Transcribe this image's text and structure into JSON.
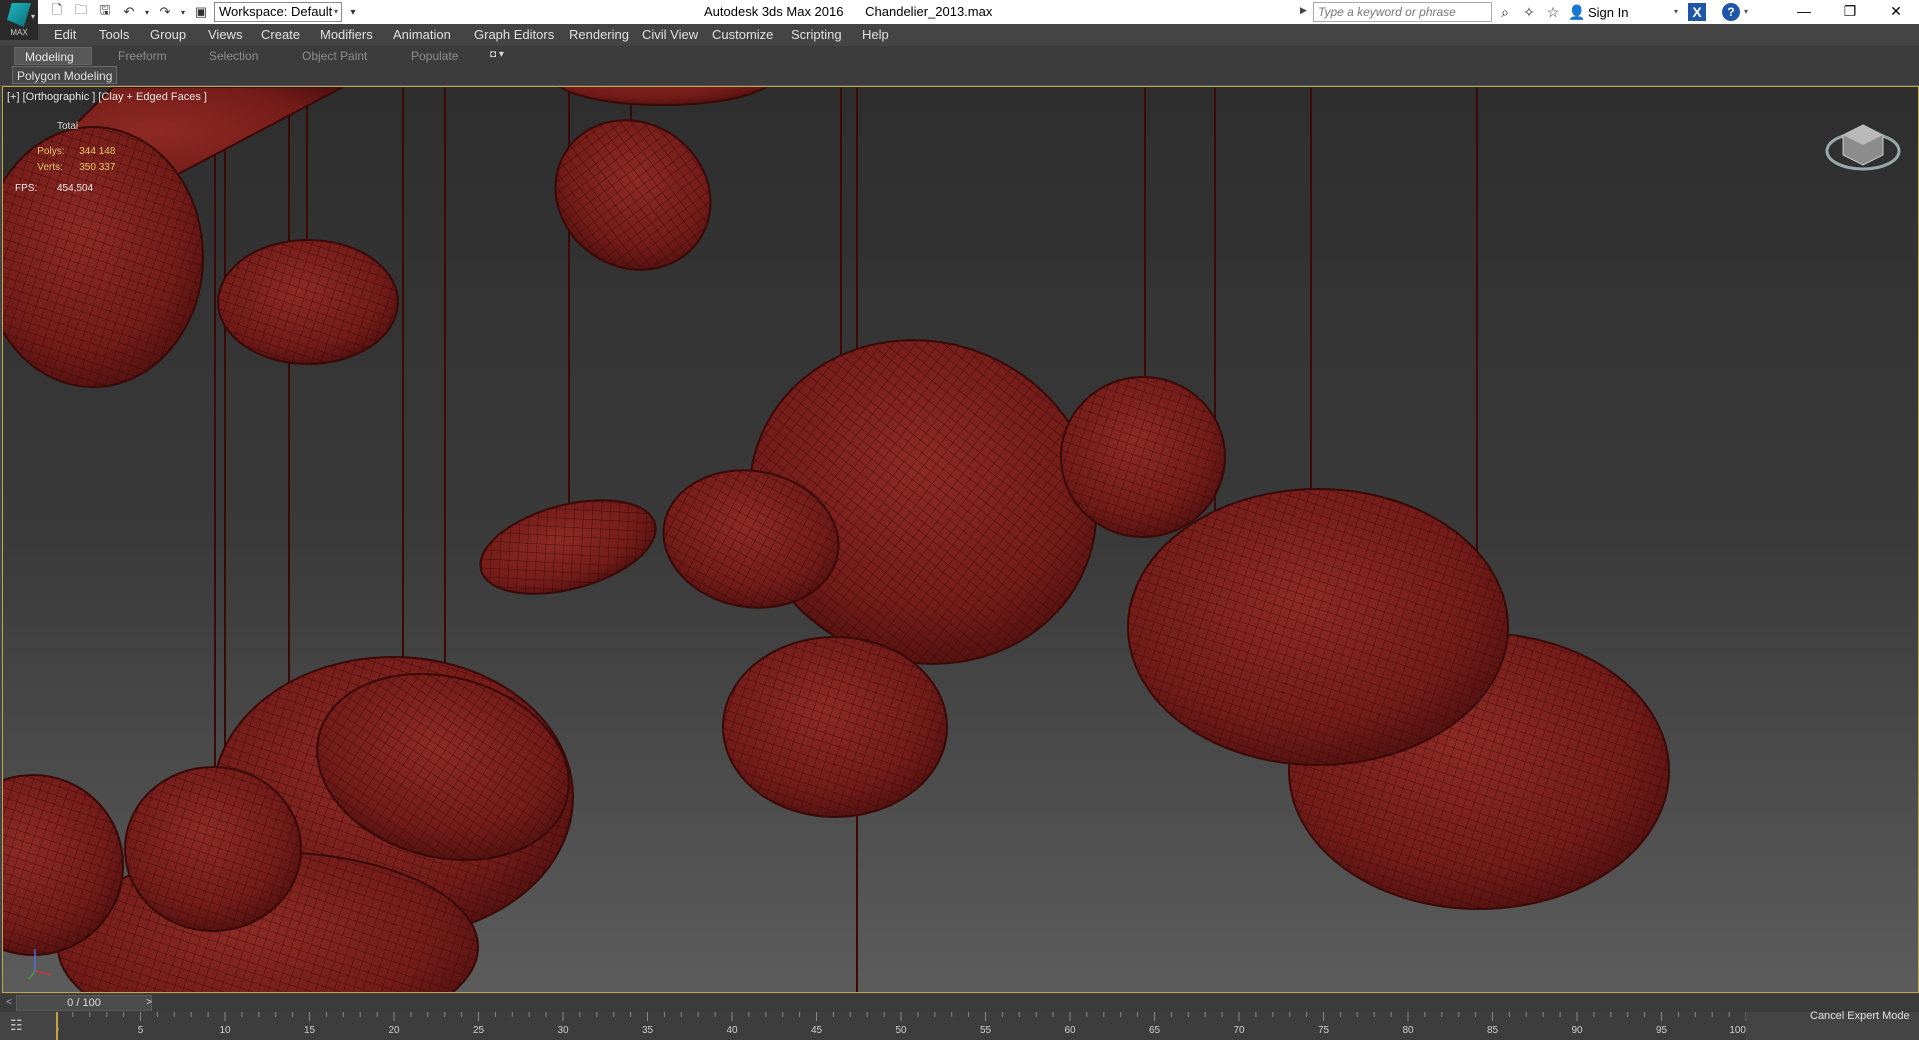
{
  "title_bar": {
    "logo_text": "MAX",
    "workspace_label": "Workspace: Default",
    "title": "Autodesk 3ds Max 2016      Chandelier_2013.max",
    "search_placeholder": "Type a keyword or phrase",
    "sign_in": "Sign In"
  },
  "menu": [
    "Edit",
    "Tools",
    "Group",
    "Views",
    "Create",
    "Modifiers",
    "Animation",
    "Graph Editors",
    "Rendering",
    "Civil View",
    "Customize",
    "Scripting",
    "Help"
  ],
  "ribbon": {
    "tabs": [
      "Modeling",
      "Freeform",
      "Selection",
      "Object Paint",
      "Populate"
    ],
    "active_tab": "Modeling",
    "panel_label": "Polygon Modeling"
  },
  "viewport": {
    "label": "[+] [Orthographic ] [Clay + Edged Faces ]",
    "stats": {
      "total_label": "Total",
      "polys_label": "Polys:",
      "polys_value": "344 148",
      "verts_label": "Verts:",
      "verts_value": "350 337",
      "fps_label": "FPS:",
      "fps_value": "454,504"
    },
    "shade_color": "#7a1f1c",
    "wire_color": "#2a0807"
  },
  "timeline": {
    "time_display": "0 / 100",
    "ticks": [
      "0",
      "5",
      "10",
      "15",
      "20",
      "25",
      "30",
      "35",
      "40",
      "45",
      "50",
      "55",
      "60",
      "65",
      "70",
      "75",
      "80",
      "85",
      "90",
      "95",
      "100"
    ],
    "current_frame": 0,
    "total_frames": 100
  },
  "status": {
    "cancel_expert_mode": "Cancel Expert Mode"
  }
}
